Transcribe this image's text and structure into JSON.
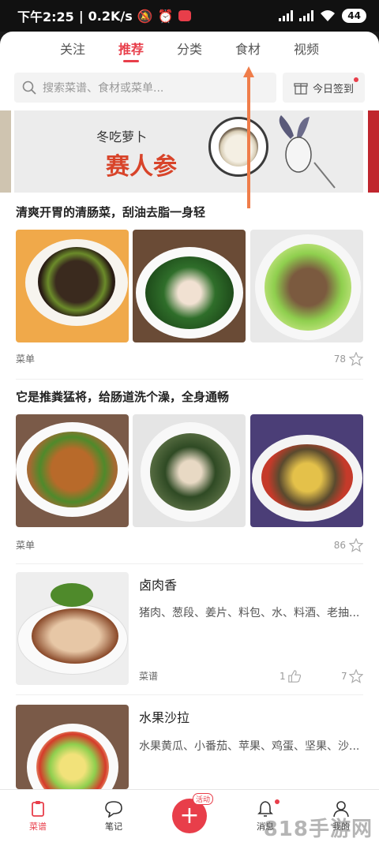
{
  "status_bar": {
    "time": "下午2:25",
    "speed": "0.2K/s",
    "battery": "44"
  },
  "tabs": [
    {
      "label": "关注",
      "active": false
    },
    {
      "label": "推荐",
      "active": true
    },
    {
      "label": "分类",
      "active": false
    },
    {
      "label": "食材",
      "active": false
    },
    {
      "label": "视频",
      "active": false
    }
  ],
  "search": {
    "placeholder": "搜索菜谱、食材或菜单..."
  },
  "checkin": {
    "label": "今日签到"
  },
  "banner": {
    "subtitle": "冬吃萝卜",
    "title": "赛人参"
  },
  "sections": [
    {
      "title": "清爽开胃的清肠菜，刮油去脂一身轻",
      "type_label": "菜单",
      "favorites": "78"
    },
    {
      "title": "它是推粪猛将，给肠道洗个澡，全身通畅",
      "type_label": "菜单",
      "favorites": "86"
    }
  ],
  "recipes": [
    {
      "title": "卤肉香",
      "ingredients": "猪肉、葱段、姜片、料包、水、料酒、老抽...",
      "category": "菜谱",
      "likes": "1",
      "favorites": "7"
    },
    {
      "title": "水果沙拉",
      "ingredients": "水果黄瓜、小番茄、苹果、鸡蛋、坚果、沙..."
    }
  ],
  "bottom_nav": [
    {
      "label": "菜谱",
      "icon": "clipboard-icon",
      "active": true
    },
    {
      "label": "笔记",
      "icon": "chat-bubble-icon",
      "active": false
    },
    {
      "label": "",
      "icon": "plus-icon",
      "badge": "活动"
    },
    {
      "label": "消息",
      "icon": "bell-icon",
      "active": false
    },
    {
      "label": "我的",
      "icon": "person-icon",
      "active": false
    }
  ],
  "watermark": "818手游网",
  "colors": {
    "accent": "#e83e4a"
  }
}
